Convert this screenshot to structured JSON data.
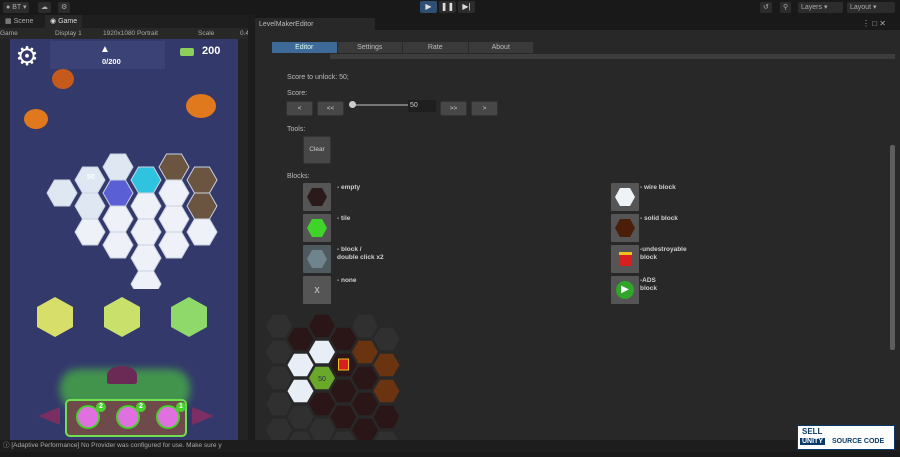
{
  "topbar": {
    "account": "BT",
    "layers": "Layers",
    "layout": "Layout"
  },
  "left_tabs": {
    "scene": "Scene",
    "game": "Game"
  },
  "game_toolbar": {
    "mode": "Game",
    "display": "Display 1",
    "resolution": "1920x1080 Portrait",
    "scale_label": "Scale",
    "scale_value": "0.4"
  },
  "game": {
    "progress": "0/200",
    "coins": "200",
    "tile_score": "50",
    "booster_counts": [
      "2",
      "2",
      "1"
    ]
  },
  "editor": {
    "window_title": "LevelMakerEditor",
    "tabs": [
      "Editor",
      "Settings",
      "Rate",
      "About"
    ],
    "active_tab": "Editor",
    "score_to_unlock": "Score to unlock: 50;",
    "score_label": "Score:",
    "score_value": "50",
    "score_slider_fraction": 0.0,
    "buttons": {
      "prev": "<",
      "prev_fast": "<<",
      "next_fast": ">>",
      "next": ">"
    },
    "tools_label": "Tools:",
    "clear": "Clear",
    "blocks_label": "Blocks:",
    "blocks_left": [
      {
        "icon": "empty",
        "label": "- empty"
      },
      {
        "icon": "tile",
        "label": "- tile"
      },
      {
        "icon": "block",
        "label": "- block /\ndouble click x2"
      },
      {
        "icon": "none",
        "label": "- none",
        "glyph": "X"
      }
    ],
    "blocks_right": [
      {
        "icon": "wire",
        "label": "- wire block"
      },
      {
        "icon": "solid",
        "label": "- solid block"
      },
      {
        "icon": "gift",
        "label": "-undestroyable\nblock"
      },
      {
        "icon": "ads",
        "label": "-ADS\nblock"
      }
    ],
    "grid": [
      [
        "f",
        "f",
        "f",
        "f",
        "f"
      ],
      [
        "d",
        "w",
        "w",
        "f",
        "f"
      ],
      [
        "d",
        "w",
        "g",
        "d",
        "f"
      ],
      [
        "d",
        "x",
        "d",
        "d",
        "f"
      ],
      [
        "f",
        "b",
        "d",
        "d",
        "d"
      ],
      [
        "f",
        "b",
        "b",
        "d",
        "f"
      ]
    ],
    "grid_tile_score": "50"
  },
  "status": "[Adaptive Performance] No Provider was configured for use. Make sure y",
  "watermark": {
    "line1": "SELL",
    "line2": "UNITY",
    "line3": "SOURCE CODE"
  }
}
